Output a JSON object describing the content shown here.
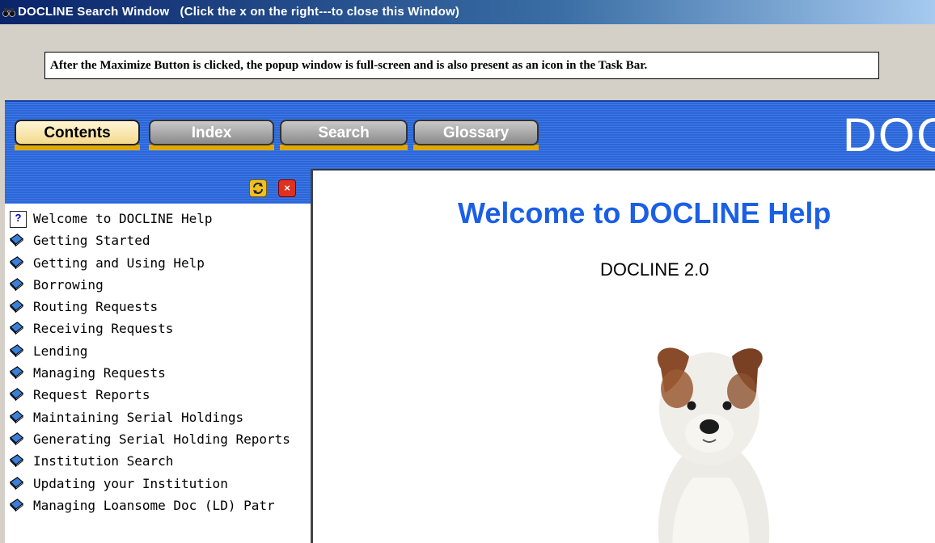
{
  "window": {
    "title": "DOCLINE Search Window",
    "title_hint": "(Click the x on the right---to close this Window)"
  },
  "note": "After the Maximize Button is clicked, the popup window is full-screen and is also present as an icon in the Task Bar.",
  "tabs": [
    {
      "label": "Contents",
      "active": true
    },
    {
      "label": "Index",
      "active": false
    },
    {
      "label": "Search",
      "active": false
    },
    {
      "label": "Glossary",
      "active": false
    }
  ],
  "logo_text": "DOC",
  "toc": [
    {
      "label": "Welcome to DOCLINE Help",
      "icon": "help-topic-icon"
    },
    {
      "label": "Getting Started",
      "icon": "book-icon"
    },
    {
      "label": "Getting and Using Help",
      "icon": "book-icon"
    },
    {
      "label": "Borrowing",
      "icon": "book-icon"
    },
    {
      "label": "Routing Requests",
      "icon": "book-icon"
    },
    {
      "label": "Receiving Requests",
      "icon": "book-icon"
    },
    {
      "label": "Lending",
      "icon": "book-icon"
    },
    {
      "label": "Managing Requests",
      "icon": "book-icon"
    },
    {
      "label": "Request Reports",
      "icon": "book-icon"
    },
    {
      "label": "Maintaining Serial Holdings",
      "icon": "book-icon"
    },
    {
      "label": "Generating Serial Holding Reports",
      "icon": "book-icon"
    },
    {
      "label": "Institution Search",
      "icon": "book-icon"
    },
    {
      "label": "Updating your Institution",
      "icon": "book-icon"
    },
    {
      "label": "Managing Loansome Doc (LD) Patr",
      "icon": "book-icon"
    }
  ],
  "content": {
    "heading": "Welcome to DOCLINE Help",
    "version": "DOCLINE 2.0"
  },
  "colors": {
    "tab_bar": "#2d66d6",
    "heading": "#1a5fe6",
    "active_tab": "#f3d98c"
  }
}
